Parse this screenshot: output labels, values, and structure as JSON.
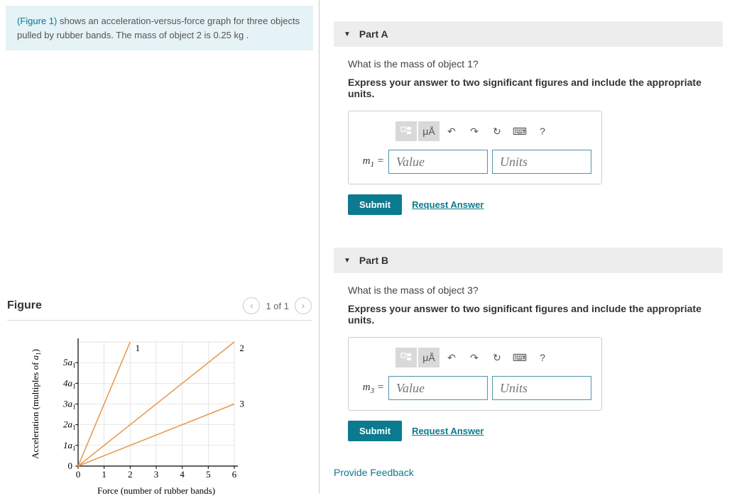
{
  "prompt": {
    "figure_link": "(Figure 1)",
    "text_after": " shows an acceleration-versus-force graph for three objects pulled by rubber bands. The mass of object 2 is 0.25 kg ."
  },
  "figure": {
    "title": "Figure",
    "nav_text": "1 of 1"
  },
  "partA": {
    "label": "Part A",
    "question": "What is the mass of object 1?",
    "instruction": "Express your answer to two significant figures and include the appropriate units.",
    "var_label_html": "m₁ =",
    "value_placeholder": "Value",
    "units_placeholder": "Units",
    "submit": "Submit",
    "request": "Request Answer"
  },
  "partB": {
    "label": "Part B",
    "question": "What is the mass of object 3?",
    "instruction": "Express your answer to two significant figures and include the appropriate units.",
    "var_label_html": "m₃ =",
    "value_placeholder": "Value",
    "units_placeholder": "Units",
    "submit": "Submit",
    "request": "Request Answer"
  },
  "feedback": "Provide Feedback",
  "icons": {
    "templates": "▭",
    "units": "μÅ",
    "undo": "↶",
    "redo": "↷",
    "reset": "↻",
    "keyboard": "⌨",
    "help": "?"
  },
  "chart_data": {
    "type": "line",
    "xlabel": "Force (number of rubber bands)",
    "ylabel": "Acceleration (multiples of a₁)",
    "x_ticks": [
      0,
      1,
      2,
      3,
      4,
      5,
      6
    ],
    "y_ticks": [
      "0",
      "1a₁",
      "2a₁",
      "3a₁",
      "4a₁",
      "5a₁"
    ],
    "xlim": [
      0,
      6
    ],
    "ylim": [
      0,
      6
    ],
    "series": [
      {
        "name": "1",
        "points": [
          [
            0,
            0
          ],
          [
            2,
            6
          ]
        ],
        "label_at": [
          2.2,
          5.7
        ]
      },
      {
        "name": "2",
        "points": [
          [
            0,
            0
          ],
          [
            6,
            6
          ]
        ],
        "label_at": [
          6.2,
          5.7
        ]
      },
      {
        "name": "3",
        "points": [
          [
            0,
            0
          ],
          [
            6,
            3
          ]
        ],
        "label_at": [
          6.2,
          3
        ]
      }
    ]
  }
}
